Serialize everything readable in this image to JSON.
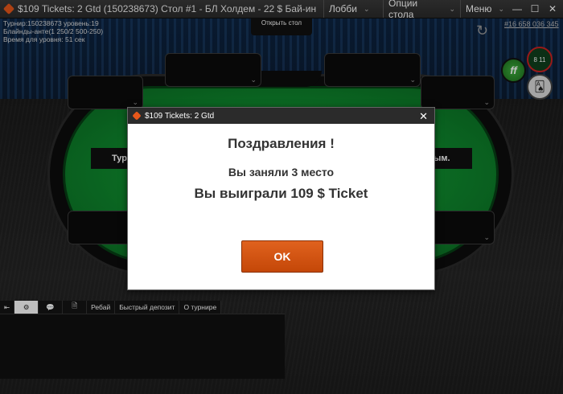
{
  "window": {
    "title": "$109 Tickets: 2 Gtd (150238673) Стол #1 -  БЛ Холдем - 22 $ Бай-ин",
    "menus": [
      {
        "label": "Лобби"
      },
      {
        "label": "Опции стола"
      },
      {
        "label": "Меню"
      }
    ],
    "minimize": "—",
    "maximize": "☐",
    "close": "✕"
  },
  "table_info": {
    "tournament": "Турнир:150238673 уровень:19",
    "blinds": "Блайнды-анте(1 250/2 500-250)",
    "level_time": "Время для уровня: 51 сек",
    "open_table": "Открыть стол",
    "tournament_number": "#16 658 036 345",
    "score_badge": "8 11",
    "ff_label": "ff",
    "banner_left": "Тур",
    "banner_right": "ым."
  },
  "bottom_toolbar": {
    "tabs": [
      {
        "label": "Ребай"
      },
      {
        "label": "Быстрый депозит"
      },
      {
        "label": "О турнире"
      }
    ]
  },
  "dialog": {
    "title": "$109 Tickets: 2 Gtd",
    "heading": "Поздравления !",
    "place_text": "Вы заняли 3 место",
    "prize_text": "Вы выиграли 109 $ Ticket",
    "ok_label": "OK"
  },
  "colors": {
    "accent": "#e0621e",
    "felt": "#0f8a2e"
  }
}
